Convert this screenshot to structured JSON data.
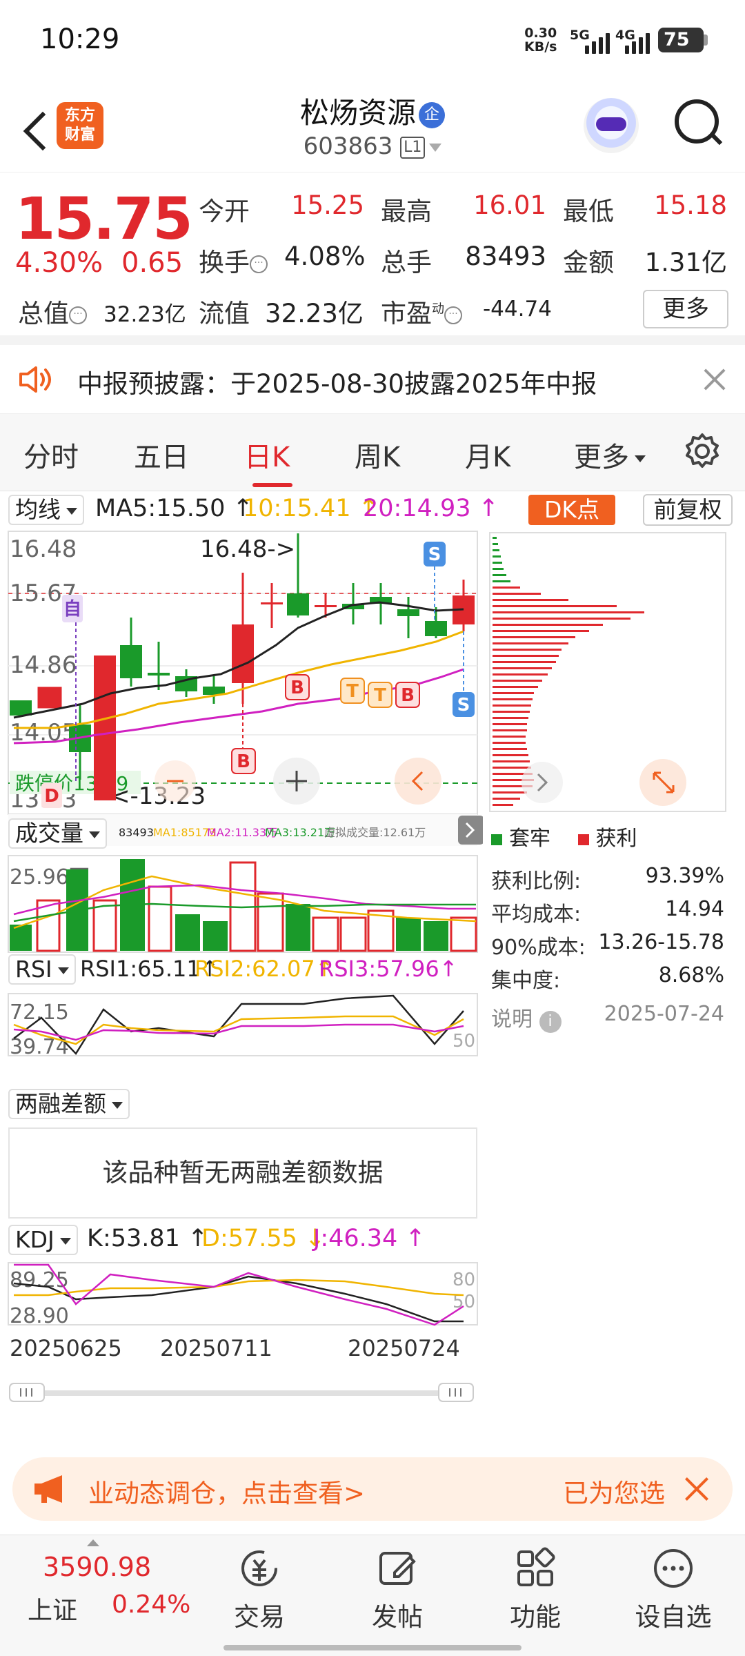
{
  "status_bar": {
    "time": "10:29",
    "net_speed": "0.30",
    "net_unit": "KB/s",
    "sig1": "5G",
    "sig2": "4G",
    "battery": "75"
  },
  "header": {
    "logo_text_1": "东方",
    "logo_text_2": "财富",
    "stock_name": "松炀资源",
    "qi_badge": "企",
    "stock_code": "603863",
    "level": "L1"
  },
  "quote": {
    "price": "15.75",
    "change_pct": "4.30%",
    "change": "0.65",
    "open_label": "今开",
    "open": "15.25",
    "high_label": "最高",
    "high": "16.01",
    "low_label": "最低",
    "low": "15.18",
    "turnover_label": "换手",
    "turnover": "4.08%",
    "volume_label": "总手",
    "volume": "83493",
    "amount_label": "金额",
    "amount": "1.31亿",
    "mktcap_label": "总值",
    "mktcap": "32.23亿",
    "float_label": "流值",
    "float": "32.23亿",
    "pe_label": "市盈",
    "pe_sup": "动",
    "pe": "-44.74",
    "more": "更多"
  },
  "notice": {
    "text": "中报预披露：于2025-08-30披露2025年中报"
  },
  "tabs": [
    {
      "label": "分时"
    },
    {
      "label": "五日"
    },
    {
      "label": "日K"
    },
    {
      "label": "周K"
    },
    {
      "label": "月K"
    },
    {
      "label": "更多"
    }
  ],
  "kline": {
    "indicator": "均线",
    "ma5": "MA5:15.50",
    "ma10": "10:15.41",
    "ma20": "20:14.93",
    "dk_button": "DK点",
    "fq_button": "前复权",
    "y_top": "16.48",
    "y_2": "15.67",
    "y_3": "14.86",
    "y_4": "14.05",
    "y_bottom": "13.23",
    "max_label": "16.48->",
    "min_label": "<-13.23",
    "limit_down": "跌停价13.59",
    "marker_self": "自",
    "marker_d": "D",
    "marker_b": "B",
    "marker_t": "T",
    "marker_s": "S"
  },
  "volume": {
    "label": "成交量",
    "v": "83493",
    "ma1": "MA1:85173",
    "ma2": "MA2:11.33万",
    "ma3": "MA3:13.21万",
    "virtual": "虚拟成交量:12.61万",
    "y_top": "25.96万"
  },
  "chip": {
    "legend_trapped": "套牢",
    "legend_profit": "获利",
    "profit_ratio_label": "获利比例:",
    "profit_ratio": "93.39%",
    "avg_cost_label": "平均成本:",
    "avg_cost": "14.94",
    "cost90_label": "90%成本:",
    "cost90": "13.26-15.78",
    "concentration_label": "集中度:",
    "concentration": "8.68%",
    "note_label": "说明",
    "date": "2025-07-24"
  },
  "rsi": {
    "label": "RSI",
    "rsi1": "RSI1:65.11",
    "rsi2": "RSI2:62.07",
    "rsi3": "RSI3:57.96",
    "y_top": "72.15",
    "y_bottom": "39.74",
    "mid": "50"
  },
  "margin": {
    "label": "两融差额",
    "nodata": "该品种暂无两融差额数据"
  },
  "kdj": {
    "label": "KDJ",
    "k": "K:53.81",
    "d": "D:57.55",
    "j": "J:46.34",
    "y_top": "89.25",
    "y_bottom": "28.90",
    "r80": "80",
    "r50": "50"
  },
  "dates": {
    "d1": "20250625",
    "d2": "20250711",
    "d3": "20250724"
  },
  "ad": {
    "text": "业动态调仓，点击查看>",
    "text2": "已为您选"
  },
  "bottom_nav": {
    "index_value": "3590.98",
    "index_name": "上证",
    "index_change": "0.24%",
    "trade": "交易",
    "post": "发帖",
    "func": "功能",
    "watch": "设自选"
  },
  "colors": {
    "up": "#e0282d",
    "down": "#1a9a2a",
    "ma10": "#f0b400",
    "ma20": "#d020c0",
    "accent": "#f06020"
  }
}
